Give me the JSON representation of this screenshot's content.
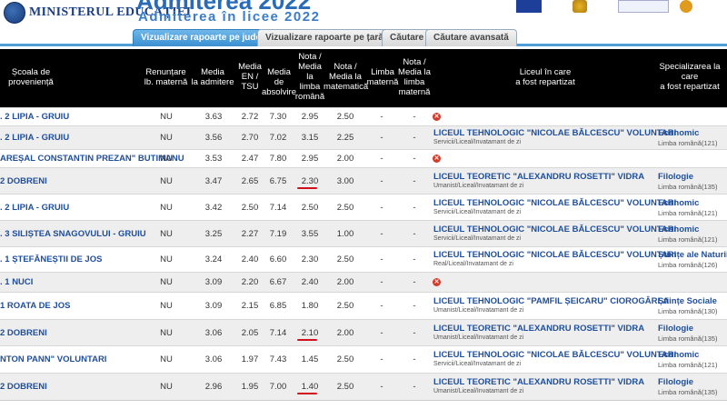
{
  "header": {
    "ministry": "MINISTERUL EDUCAȚIEI",
    "title": "Admiterea 2022",
    "subtitle": "Admiterea în licee 2022"
  },
  "tabs": [
    {
      "label": "Vizualizare rapoarte pe județ",
      "active": true
    },
    {
      "label": "Vizualizare rapoarte pe țară",
      "active": false
    },
    {
      "label": "Căutare",
      "active": false
    },
    {
      "label": "Căutare avansată",
      "active": false
    }
  ],
  "columns": {
    "school": [
      "Școala de",
      "proveniență"
    ],
    "renuntare": [
      "Renunțare",
      "lb. maternă"
    ],
    "media_adm": [
      "Media",
      "la admitere"
    ],
    "media_en": [
      "Media",
      "EN /",
      "TSU"
    ],
    "media_abs": [
      "Media",
      "de absolvire"
    ],
    "nota_ro": [
      "Nota /",
      "Media",
      "la",
      "limba",
      "română"
    ],
    "nota_mat": [
      "Nota /",
      "Media la",
      "matematică"
    ],
    "limba_mat": [
      "Limba",
      "maternă"
    ],
    "nota_lm": [
      "Nota /",
      "Media la",
      "limba",
      "maternă"
    ],
    "liceu": [
      "Liceul în care",
      "a fost repartizat"
    ],
    "spec": [
      "Specializarea la",
      "care",
      "a fost repartizat"
    ]
  },
  "rows": [
    {
      "school": ". 2 LIPIA - GRUIU",
      "ren": "NU",
      "adm": "3.63",
      "en": "2.72",
      "abs": "7.30",
      "ro": "2.95",
      "mat": "2.50",
      "lm": "-",
      "nlm": "-",
      "assigned": false
    },
    {
      "school": ". 2 LIPIA - GRUIU",
      "ren": "NU",
      "adm": "3.56",
      "en": "2.70",
      "abs": "7.02",
      "ro": "3.15",
      "mat": "2.25",
      "lm": "-",
      "nlm": "-",
      "assigned": true,
      "liceu": "LICEUL TEHNOLOGIC \"NICOLAE BĂLCESCU\" VOLUNTARI",
      "liceu_sub": "Servicii/Liceal/Invatamant de zi",
      "spec": "Economic",
      "spec_sub": "Limba română(121)"
    },
    {
      "school": "AREȘAL CONSTANTIN PREZAN\" BUTIMANU",
      "ren": "NU",
      "adm": "3.53",
      "en": "2.47",
      "abs": "7.80",
      "ro": "2.95",
      "mat": "2.00",
      "lm": "-",
      "nlm": "-",
      "assigned": false
    },
    {
      "school": "2 DOBRENI",
      "ren": "NU",
      "adm": "3.47",
      "en": "2.65",
      "abs": "6.75",
      "ro": "2.30",
      "mat": "3.00",
      "lm": "-",
      "nlm": "-",
      "assigned": true,
      "underline": true,
      "liceu": "LICEUL TEORETIC \"ALEXANDRU ROSETTI\" VIDRA",
      "liceu_sub": "Umanist/Liceal/Invatamant de zi",
      "spec": "Filologie",
      "spec_sub": "Limba română(135)"
    },
    {
      "school": ". 2 LIPIA - GRUIU",
      "ren": "NU",
      "adm": "3.42",
      "en": "2.50",
      "abs": "7.14",
      "ro": "2.50",
      "mat": "2.50",
      "lm": "-",
      "nlm": "-",
      "assigned": true,
      "liceu": "LICEUL TEHNOLOGIC \"NICOLAE BĂLCESCU\" VOLUNTARI",
      "liceu_sub": "Servicii/Liceal/Invatamant de zi",
      "spec": "Economic",
      "spec_sub": "Limba română(121)"
    },
    {
      "school": ". 3 SILIȘTEA SNAGOVULUI - GRUIU",
      "ren": "NU",
      "adm": "3.25",
      "en": "2.27",
      "abs": "7.19",
      "ro": "3.55",
      "mat": "1.00",
      "lm": "-",
      "nlm": "-",
      "assigned": true,
      "liceu": "LICEUL TEHNOLOGIC \"NICOLAE BĂLCESCU\" VOLUNTARI",
      "liceu_sub": "Servicii/Liceal/Invatamant de zi",
      "spec": "Economic",
      "spec_sub": "Limba română(121)"
    },
    {
      "school": ". 1 ȘTEFĂNEȘTII DE JOS",
      "ren": "NU",
      "adm": "3.24",
      "en": "2.40",
      "abs": "6.60",
      "ro": "2.30",
      "mat": "2.50",
      "lm": "-",
      "nlm": "-",
      "assigned": true,
      "liceu": "LICEUL TEHNOLOGIC \"NICOLAE BĂLCESCU\" VOLUNTARI",
      "liceu_sub": "Real/Liceal/Invatamant de zi",
      "spec": "Științe ale Naturii",
      "spec_sub": "Limba română(126)"
    },
    {
      "school": ". 1 NUCI",
      "ren": "NU",
      "adm": "3.09",
      "en": "2.20",
      "abs": "6.67",
      "ro": "2.40",
      "mat": "2.00",
      "lm": "-",
      "nlm": "-",
      "assigned": false
    },
    {
      "school": "1 ROATA DE JOS",
      "ren": "NU",
      "adm": "3.09",
      "en": "2.15",
      "abs": "6.85",
      "ro": "1.80",
      "mat": "2.50",
      "lm": "-",
      "nlm": "-",
      "assigned": true,
      "liceu": "LICEUL TEHNOLOGIC \"PAMFIL ȘEICARU\" CIOROGÂRLA",
      "liceu_sub": "Umanist/Liceal/Invatamant de zi",
      "spec": "Științe Sociale",
      "spec_sub": "Limba română(130)"
    },
    {
      "school": "2 DOBRENI",
      "ren": "NU",
      "adm": "3.06",
      "en": "2.05",
      "abs": "7.14",
      "ro": "2.10",
      "mat": "2.00",
      "lm": "-",
      "nlm": "-",
      "assigned": true,
      "underline": true,
      "liceu": "LICEUL TEORETIC \"ALEXANDRU ROSETTI\" VIDRA",
      "liceu_sub": "Umanist/Liceal/Invatamant de zi",
      "spec": "Filologie",
      "spec_sub": "Limba română(135)"
    },
    {
      "school": "NTON PANN\" VOLUNTARI",
      "ren": "NU",
      "adm": "3.06",
      "en": "1.97",
      "abs": "7.43",
      "ro": "1.45",
      "mat": "2.50",
      "lm": "-",
      "nlm": "-",
      "assigned": true,
      "liceu": "LICEUL TEHNOLOGIC \"NICOLAE BĂLCESCU\" VOLUNTARI",
      "liceu_sub": "Servicii/Liceal/Invatamant de zi",
      "spec": "Economic",
      "spec_sub": "Limba română(121)"
    },
    {
      "school": "2 DOBRENI",
      "ren": "NU",
      "adm": "2.96",
      "en": "1.95",
      "abs": "7.00",
      "ro": "1.40",
      "mat": "2.50",
      "lm": "-",
      "nlm": "-",
      "assigned": true,
      "underline": true,
      "liceu": "LICEUL TEORETIC \"ALEXANDRU ROSETTI\" VIDRA",
      "liceu_sub": "Umanist/Liceal/Invatamant de zi",
      "spec": "Filologie",
      "spec_sub": "Limba română(135)"
    }
  ],
  "colors": {
    "link": "#1f4e99",
    "tab_active": "#3a8fd0",
    "header_bg": "#000000",
    "not_assigned_icon": "#d23a2a"
  }
}
